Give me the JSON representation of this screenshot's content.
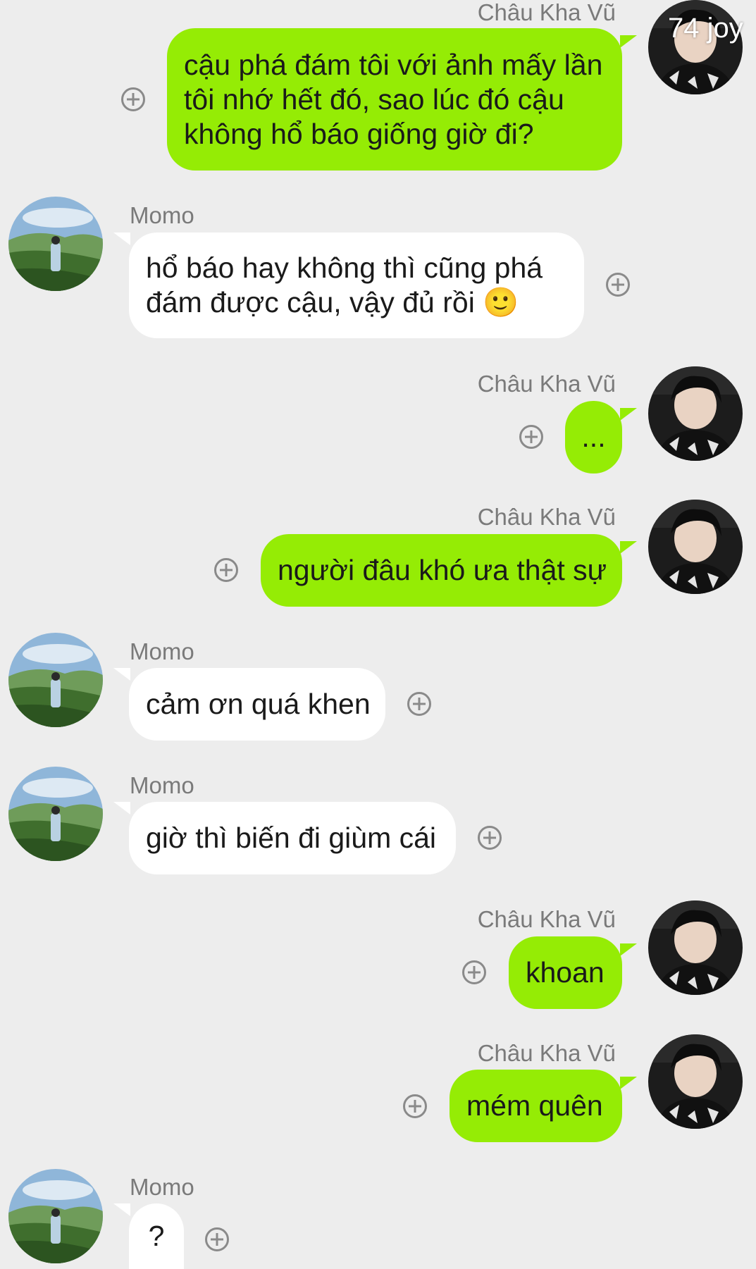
{
  "contacts": {
    "self_name": "Châu Kha Vũ",
    "other_name": "Momo"
  },
  "overlay": {
    "watermark": "74 joy"
  },
  "messages": [
    {
      "sender": "Châu Kha Vũ",
      "side": "right",
      "text": "cậu phá đám tôi với ảnh mấy lần tôi nhớ hết đó, sao lúc đó cậu không hổ báo giống giờ đi?"
    },
    {
      "sender": "Momo",
      "side": "left",
      "text": "hổ báo hay không thì cũng phá đám được cậu, vậy đủ rồi 🙂"
    },
    {
      "sender": "Châu Kha Vũ",
      "side": "right",
      "text": "..."
    },
    {
      "sender": "Châu Kha Vũ",
      "side": "right",
      "text": "người đâu khó ưa thật sự"
    },
    {
      "sender": "Momo",
      "side": "left",
      "text": "cảm ơn quá khen"
    },
    {
      "sender": "Momo",
      "side": "left",
      "text": "giờ thì biến đi giùm cái"
    },
    {
      "sender": "Châu Kha Vũ",
      "side": "right",
      "text": "khoan"
    },
    {
      "sender": "Châu Kha Vũ",
      "side": "right",
      "text": "mém quên"
    },
    {
      "sender": "Momo",
      "side": "left",
      "text": "?"
    }
  ],
  "colors": {
    "background": "#ededed",
    "self_bubble": "#95ec05",
    "other_bubble": "#ffffff",
    "name_text": "#7a7a7a"
  },
  "icons": {
    "add": "plus-circle-icon",
    "self_avatar": "avatar-chau-kha-vu",
    "other_avatar": "avatar-momo"
  }
}
